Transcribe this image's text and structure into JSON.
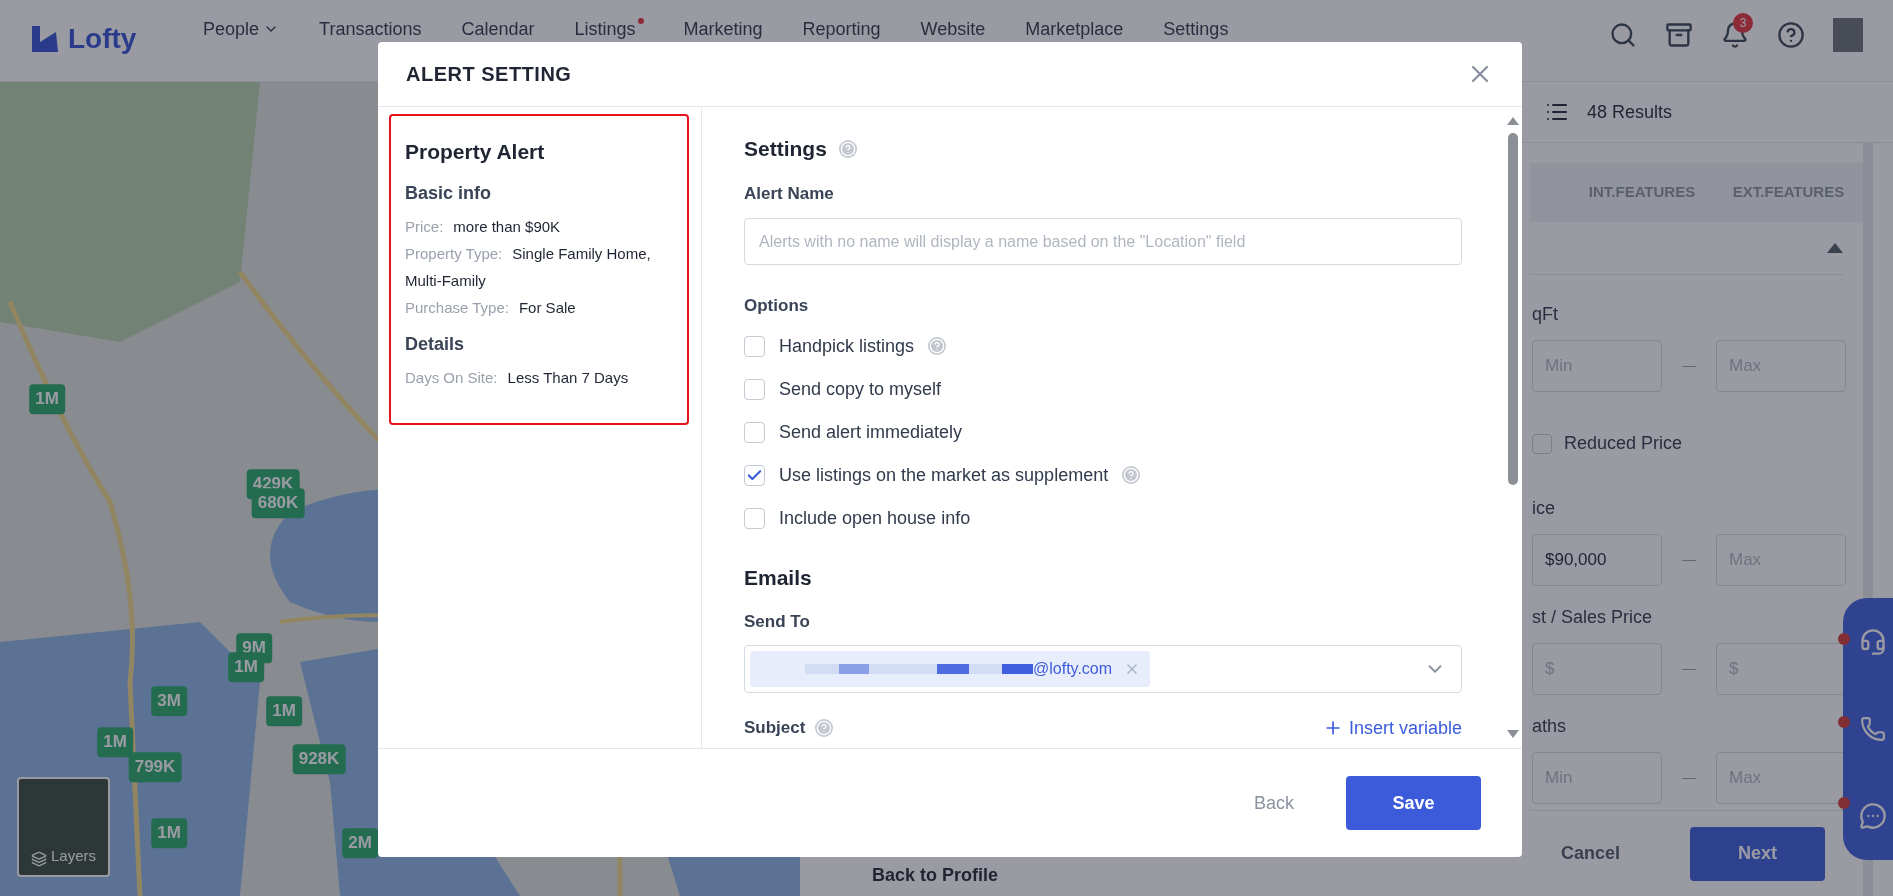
{
  "nav": {
    "logo": "Lofty",
    "items": [
      {
        "label": "People",
        "dropdown": true,
        "dot": false
      },
      {
        "label": "Transactions",
        "dropdown": false,
        "dot": false
      },
      {
        "label": "Calendar",
        "dropdown": false,
        "dot": false
      },
      {
        "label": "Listings",
        "dropdown": false,
        "dot": true
      },
      {
        "label": "Marketing",
        "dropdown": false,
        "dot": false
      },
      {
        "label": "Reporting",
        "dropdown": false,
        "dot": false
      },
      {
        "label": "Website",
        "dropdown": false,
        "dot": false
      },
      {
        "label": "Marketplace",
        "dropdown": false,
        "dot": false
      },
      {
        "label": "Settings",
        "dropdown": false,
        "dot": false
      }
    ],
    "notifications": "3"
  },
  "map": {
    "markers": [
      "1M",
      "429K",
      "680K",
      "9M",
      "1M",
      "1M",
      "3M",
      "1M",
      "799K",
      "928K",
      "1M",
      "2M"
    ],
    "layers": "Layers"
  },
  "results": "48 Results",
  "filter_tabs": [
    "INT.FEATURES",
    "EXT.FEATURES"
  ],
  "filters": [
    {
      "kind": "range",
      "label": "qFt",
      "min": {
        "placeholder": "Min"
      },
      "max": {
        "placeholder": "Max"
      }
    },
    {
      "kind": "checkbox",
      "label": "Reduced Price",
      "checked": false
    },
    {
      "kind": "range",
      "label": "ice",
      "min": {
        "value": "$90,000"
      },
      "max": {
        "placeholder": "Max"
      }
    },
    {
      "kind": "range",
      "label": "st / Sales Price",
      "min": {
        "placeholder": "$"
      },
      "max": {
        "placeholder": "$"
      }
    },
    {
      "kind": "range",
      "label": "aths",
      "min": {
        "placeholder": "Min"
      },
      "max": {
        "placeholder": "Max"
      }
    }
  ],
  "back_link": "Back to Profile",
  "footer_buttons": {
    "cancel": "Cancel",
    "next": "Next"
  },
  "modal": {
    "title": "ALERT SETTING",
    "summary": {
      "title": "Property Alert",
      "sections": [
        {
          "heading": "Basic info",
          "rows": [
            {
              "label": "Price:",
              "value": "more than $90K"
            },
            {
              "label": "Property Type:",
              "value": "Single Family Home, Multi-Family"
            },
            {
              "label": "Purchase Type:",
              "value": "For Sale"
            }
          ]
        },
        {
          "heading": "Details",
          "rows": [
            {
              "label": "Days On Site:",
              "value": "Less Than 7 Days"
            }
          ]
        }
      ]
    },
    "settings": {
      "title": "Settings",
      "alert_name": {
        "label": "Alert Name",
        "placeholder": "Alerts with no name will display a name based on the \"Location\" field"
      },
      "options_label": "Options",
      "options": [
        {
          "label": "Handpick listings",
          "checked": false,
          "help": true
        },
        {
          "label": "Send copy to myself",
          "checked": false,
          "help": false
        },
        {
          "label": "Send alert immediately",
          "checked": false,
          "help": false
        },
        {
          "label": "Use listings on the market as supplement",
          "checked": true,
          "help": true
        },
        {
          "label": "Include open house info",
          "checked": false,
          "help": false
        }
      ]
    },
    "emails": {
      "title": "Emails",
      "send_to": {
        "label": "Send To",
        "recipients": [
          {
            "email": "@lofty.com"
          }
        ]
      },
      "subject": {
        "label": "Subject"
      },
      "insert_variable": "Insert variable"
    },
    "buttons": {
      "back": "Back",
      "save": "Save"
    }
  }
}
